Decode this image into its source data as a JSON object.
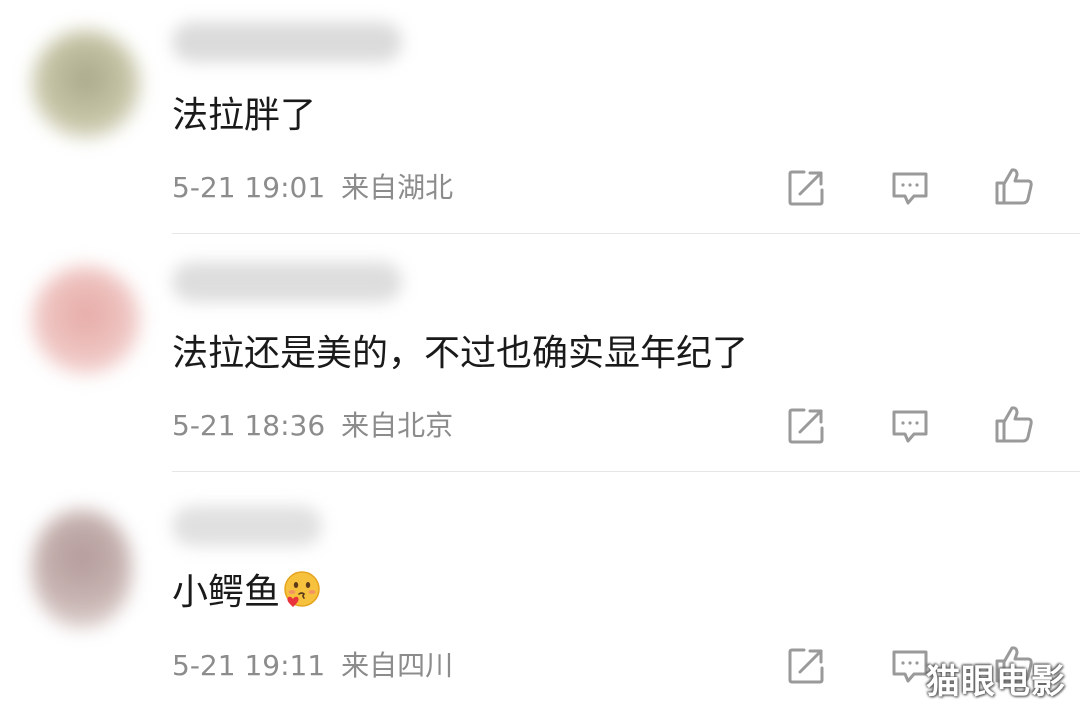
{
  "comments": [
    {
      "text": "法拉胖了",
      "time": "5-21 19:01",
      "location": "来自湖北",
      "avatar_color": "#b9b897"
    },
    {
      "text": "法拉还是美的，不过也确实显年纪了",
      "time": "5-21 18:36",
      "location": "来自北京",
      "avatar_color": "#e9b8b4"
    },
    {
      "text": "小鳄鱼",
      "emoji": "blushing-kiss-emoji",
      "time": "5-21 19:11",
      "location": "来自四川",
      "avatar_color": "#a89596"
    }
  ],
  "icons": {
    "share": "share-icon",
    "reply": "comment-icon",
    "like": "thumbs-up-icon",
    "color": "#9a9a9a"
  },
  "watermark": "猫眼电影"
}
